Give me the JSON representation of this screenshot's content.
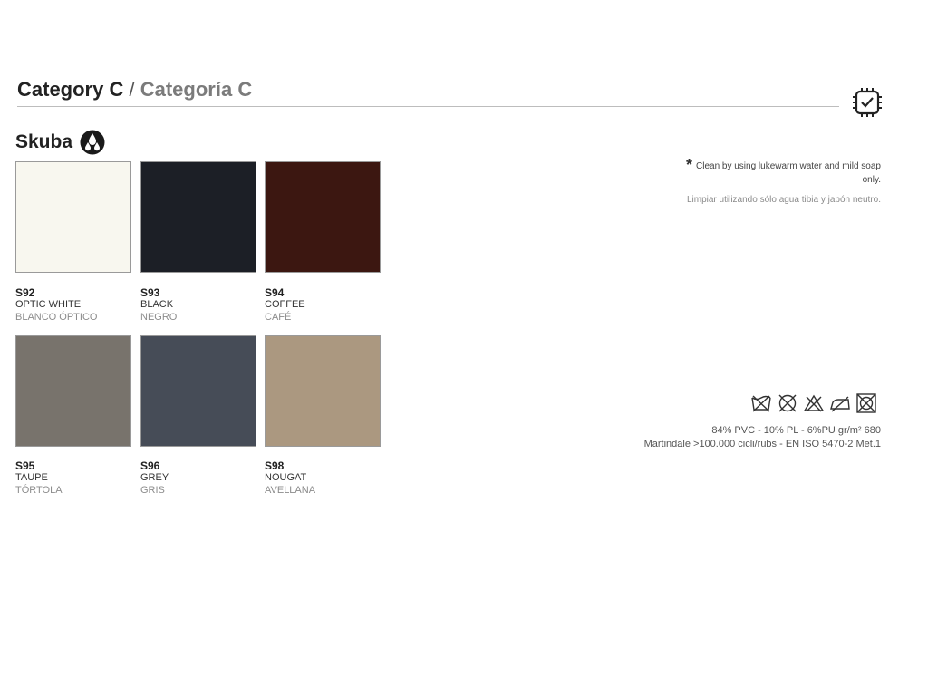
{
  "header": {
    "title_en": "Category C",
    "separator": "/",
    "title_es": "Categoría C"
  },
  "material": {
    "name": "Skuba"
  },
  "swatches": [
    {
      "code": "S92",
      "name_en": "OPTIC WHITE",
      "name_es": "BLANCO ÓPTICO",
      "color": "#f8f7ef"
    },
    {
      "code": "S93",
      "name_en": "BLACK",
      "name_es": "NEGRO",
      "color": "#1c1f26"
    },
    {
      "code": "S94",
      "name_en": "COFFEE",
      "name_es": "CAFÉ",
      "color": "#3c1711"
    },
    {
      "code": "S95",
      "name_en": "TAUPE",
      "name_es": "TÓRTOLA",
      "color": "#78736c"
    },
    {
      "code": "S96",
      "name_en": "GREY",
      "name_es": "GRIS",
      "color": "#464c57"
    },
    {
      "code": "S98",
      "name_en": "NOUGAT",
      "name_es": "AVELLANA",
      "color": "#ab9880"
    }
  ],
  "care": {
    "asterisk": "*",
    "en": "Clean by using lukewarm water and mild soap only.",
    "es": "Limpiar utilizando sólo agua tibia y jabón neutro."
  },
  "wash_icons": [
    "do-not-wash-icon",
    "do-not-dry-clean-icon",
    "do-not-bleach-icon",
    "do-not-iron-icon",
    "do-not-tumble-dry-icon"
  ],
  "specs": {
    "composition": "84% PVC - 10% PL - 6%PU   gr/m² 680",
    "abrasion": "Martindale >100.000 cicli/rubs - EN ISO 5470-2 Met.1"
  }
}
